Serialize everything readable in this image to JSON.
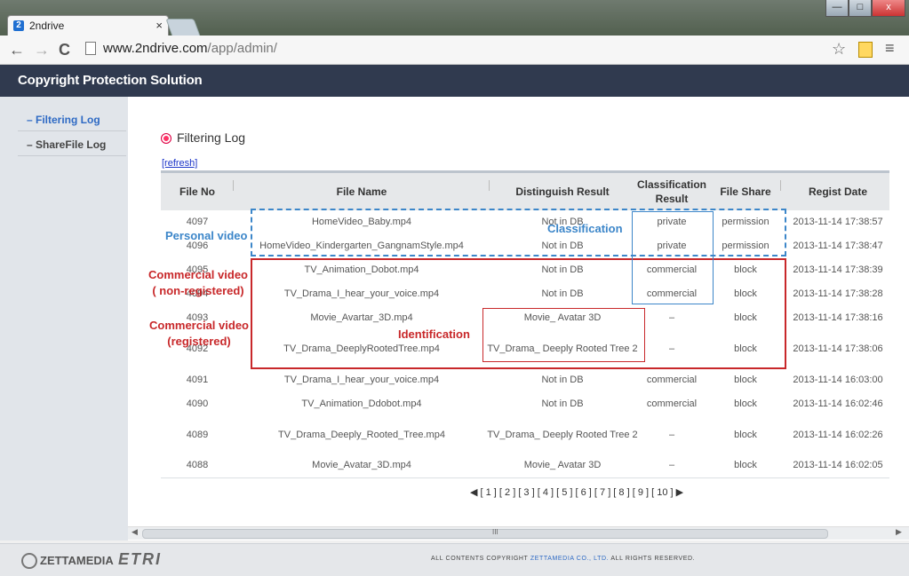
{
  "browser": {
    "tab_title": "2ndrive",
    "tab_close": "×",
    "favicon_letter": "2",
    "url_host": "www.2ndrive.com",
    "url_path": "/app/admin/",
    "window_buttons": {
      "minimize": "—",
      "maximize": "□",
      "close": "x"
    }
  },
  "app": {
    "title": "Copyright Protection Solution"
  },
  "sidebar": {
    "items": [
      {
        "label": "– Filtering Log"
      },
      {
        "label": "– ShareFile Log"
      }
    ]
  },
  "main": {
    "section_title": "Filtering Log",
    "refresh_label": "[refresh]",
    "columns": [
      "File No",
      "File Name",
      "Distinguish Result",
      "Classification Result",
      "File Share",
      "Regist Date"
    ],
    "rows": [
      {
        "no": "4097",
        "name": "HomeVideo_Baby.mp4",
        "dist": "Not in DB",
        "class": "private",
        "share": "permission",
        "date": "2013-11-14 17:38:57"
      },
      {
        "no": "4096",
        "name": "HomeVideo_Kindergarten_GangnamStyle.mp4",
        "dist": "Not in DB",
        "class": "private",
        "share": "permission",
        "date": "2013-11-14 17:38:47"
      },
      {
        "no": "4095",
        "name": "TV_Animation_Dobot.mp4",
        "dist": "Not in DB",
        "class": "commercial",
        "share": "block",
        "date": "2013-11-14 17:38:39"
      },
      {
        "no": "4094",
        "name": "TV_Drama_I_hear_your_voice.mp4",
        "dist": "Not in DB",
        "class": "commercial",
        "share": "block",
        "date": "2013-11-14 17:38:28"
      },
      {
        "no": "4093",
        "name": "Movie_Avartar_3D.mp4",
        "dist": "Movie_ Avatar 3D",
        "class": "–",
        "share": "block",
        "date": "2013-11-14 17:38:16"
      },
      {
        "no": "4092",
        "name": "TV_Drama_DeeplyRootedTree.mp4",
        "dist": "TV_Drama_ Deeply Rooted Tree 2",
        "class": "–",
        "share": "block",
        "date": "2013-11-14 17:38:06"
      },
      {
        "no": "4091",
        "name": "TV_Drama_I_hear_your_voice.mp4",
        "dist": "Not in DB",
        "class": "commercial",
        "share": "block",
        "date": "2013-11-14 16:03:00"
      },
      {
        "no": "4090",
        "name": "TV_Animation_Ddobot.mp4",
        "dist": "Not in DB",
        "class": "commercial",
        "share": "block",
        "date": "2013-11-14 16:02:46"
      },
      {
        "no": "4089",
        "name": "TV_Drama_Deeply_Rooted_Tree.mp4",
        "dist": "TV_Drama_ Deeply Rooted Tree 2",
        "class": "–",
        "share": "block",
        "date": "2013-11-14 16:02:26"
      },
      {
        "no": "4088",
        "name": "Movie_Avatar_3D.mp4",
        "dist": "Movie_ Avatar 3D",
        "class": "–",
        "share": "block",
        "date": "2013-11-14 16:02:05"
      }
    ],
    "pagination": "◀ [ 1 ] [ 2 ] [ 3 ] [ 4 ] [ 5 ] [ 6 ] [ 7 ] [ 8 ] [ 9 ] [ 10 ] ▶"
  },
  "annotations": {
    "personal": "Personal video",
    "classification": "Classification",
    "commercial_nonreg": "Commercial video\n( non-registered)",
    "commercial_reg": "Commercial video\n(registered)",
    "identification": "Identification"
  },
  "scrollbar": {
    "grip": "III",
    "left": "◀",
    "right": "▶"
  },
  "footer": {
    "zettamedia": "ZETTAMEDIA",
    "etri": "ETRI",
    "copyright_pre": "ALL CONTENTS COPYRIGHT ",
    "copyright_co": "ZETTAMEDIA CO., LTD.",
    "copyright_post": " ALL RIGHTS RESERVED."
  },
  "colors": {
    "header_bg": "#303a4f",
    "accent_blue": "#3c86c9",
    "accent_red": "#c8282a"
  }
}
